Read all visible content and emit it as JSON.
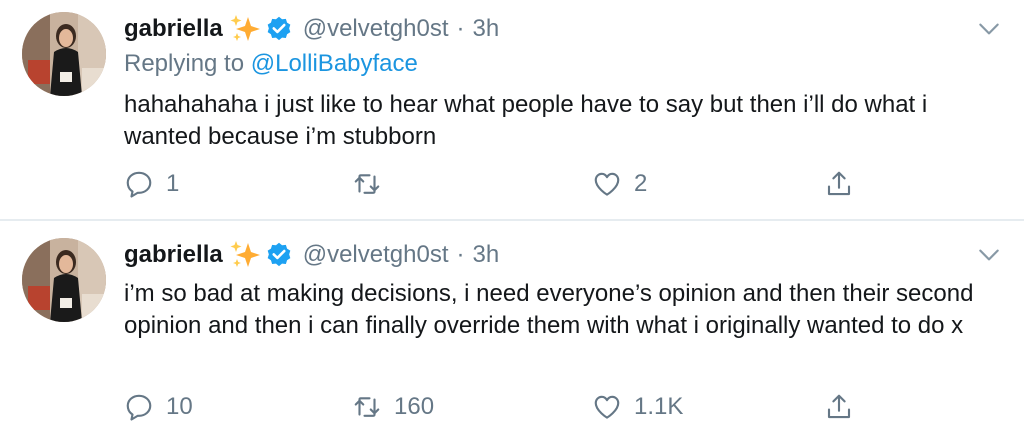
{
  "tweets": [
    {
      "display_name": "gabriella",
      "handle": "@velvetgh0st",
      "separator": "·",
      "time": "3h",
      "replying_prefix": "Replying to",
      "replying_to": "@LolliBabyface",
      "text": "hahahahaha i just like to hear what people have to say but then i’ll do what i wanted because i’m stubborn",
      "reply_count": "1",
      "retweet_count": "",
      "like_count": "2"
    },
    {
      "display_name": "gabriella",
      "handle": "@velvetgh0st",
      "separator": "·",
      "time": "3h",
      "text": "i’m so bad at making decisions, i need everyone’s opinion and then their second opinion and then i can finally override them with what i originally wanted to do x",
      "reply_count": "10",
      "retweet_count": "160",
      "like_count": "1.1K"
    }
  ],
  "colors": {
    "text": "#14171a",
    "secondary": "#657786",
    "link": "#1b95e0",
    "verified": "#1da1f2",
    "sparkle": "#ffac33",
    "divider": "#e6ecf0"
  },
  "icons": {
    "reply": "speech-bubble-icon",
    "retweet": "retweet-arrows-icon",
    "like": "heart-icon",
    "share": "share-upload-icon",
    "menu": "chevron-down-icon",
    "badge": "verified-badge-icon",
    "emoji": "sparkles-icon"
  }
}
